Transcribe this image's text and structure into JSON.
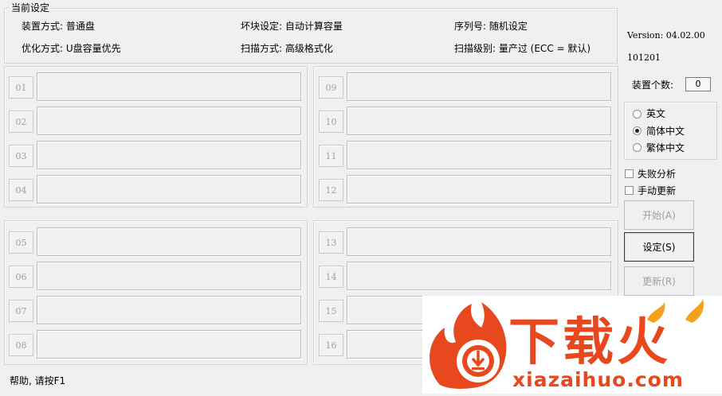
{
  "current_settings": {
    "legend": "当前设定",
    "rows": [
      [
        "装置方式: 普通盘",
        "坏块设定: 自动计算容量",
        "序列号: 随机设定"
      ],
      [
        "优化方式: U盘容量优先",
        "扫描方式: 高级格式化",
        "扫描级别: 量产过 (ECC = 默认)"
      ]
    ]
  },
  "version": {
    "line1": "Version: 04.02.00",
    "line2": "101201"
  },
  "device_count": {
    "label": "装置个数:",
    "value": "0"
  },
  "language": {
    "options": [
      "英文",
      "简体中文",
      "繁体中文"
    ],
    "selected": "简体中文"
  },
  "options": {
    "fail_analysis": "失败分析",
    "manual_update": "手动更新"
  },
  "buttons": {
    "start": "开始(A)",
    "settings": "设定(S)",
    "update": "更新(R)"
  },
  "slots": [
    "01",
    "02",
    "03",
    "04",
    "05",
    "06",
    "07",
    "08",
    "09",
    "10",
    "11",
    "12",
    "13",
    "14",
    "15",
    "16"
  ],
  "status": "帮助, 请按F1",
  "watermark": {
    "brand": "下载火",
    "url": "xiazaihuo.com",
    "color_primary": "#e8481e",
    "color_secondary": "#f5a01a"
  }
}
